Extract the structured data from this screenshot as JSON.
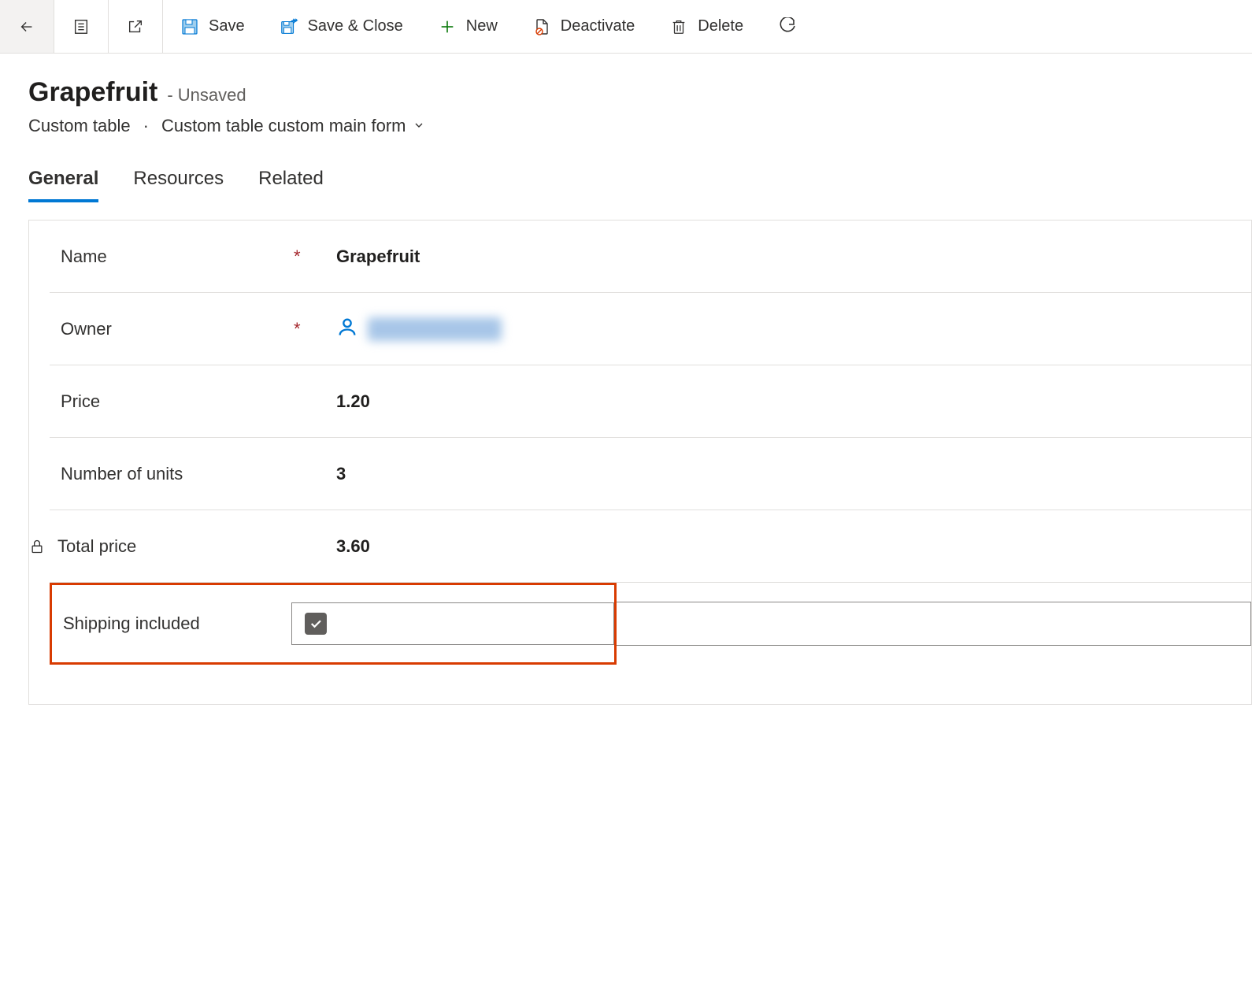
{
  "toolbar": {
    "save": "Save",
    "save_close": "Save & Close",
    "new": "New",
    "deactivate": "Deactivate",
    "delete": "Delete"
  },
  "header": {
    "title": "Grapefruit",
    "status": "- Unsaved",
    "entity": "Custom table",
    "form": "Custom table custom main form"
  },
  "tabs": {
    "general": "General",
    "resources": "Resources",
    "related": "Related"
  },
  "fields": {
    "name": {
      "label": "Name",
      "value": "Grapefruit",
      "required": "*"
    },
    "owner": {
      "label": "Owner",
      "required": "*"
    },
    "price": {
      "label": "Price",
      "value": "1.20"
    },
    "units": {
      "label": "Number of units",
      "value": "3"
    },
    "total": {
      "label": "Total price",
      "value": "3.60"
    },
    "shipping": {
      "label": "Shipping included",
      "checked": true
    }
  }
}
